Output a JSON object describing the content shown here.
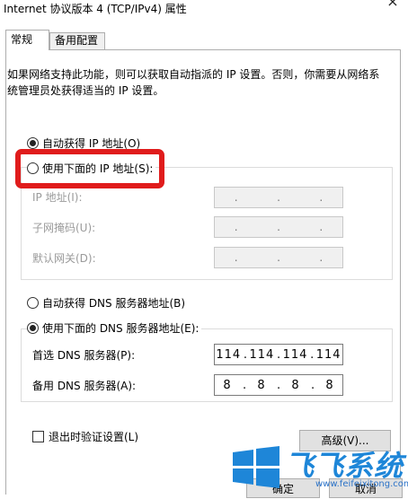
{
  "window": {
    "title": "Internet 协议版本 4 (TCP/IPv4) 属性",
    "close_label": "×"
  },
  "tabs": [
    {
      "label": "常规",
      "selected": true
    },
    {
      "label": "备用配置",
      "selected": false
    }
  ],
  "description": "如果网络支持此功能，则可以获取自动指派的 IP 设置。否则，你需要从网络系统管理员处获得适当的 IP 设置。",
  "ip_section": {
    "auto_label": "自动获得 IP 地址(O)",
    "auto_checked": true,
    "manual_label": "使用下面的 IP 地址(S):",
    "manual_checked": false,
    "fields": [
      {
        "label": "IP 地址(I):",
        "value": ". . ."
      },
      {
        "label": "子网掩码(U):",
        "value": ". . ."
      },
      {
        "label": "默认网关(D):",
        "value": ". . ."
      }
    ]
  },
  "dns_section": {
    "auto_label": "自动获得 DNS 服务器地址(B)",
    "auto_checked": false,
    "manual_label": "使用下面的 DNS 服务器地址(E):",
    "manual_checked": true,
    "preferred": {
      "label": "首选 DNS 服务器(P):",
      "octets": [
        "114",
        "114",
        "114",
        "114"
      ]
    },
    "alternate": {
      "label": "备用 DNS 服务器(A):",
      "octets": [
        "8",
        "8",
        "8",
        "8"
      ]
    }
  },
  "validate": {
    "label": "退出时验证设置(L)",
    "checked": false
  },
  "buttons": {
    "advanced": "高级(V)...",
    "ok": "确定",
    "cancel": "取消"
  },
  "watermark": {
    "brand": "飞飞系统",
    "url": "www.feifeixitong.com"
  },
  "colors": {
    "highlight": "#e01c1c",
    "brand_blue": "#1e86d8"
  }
}
